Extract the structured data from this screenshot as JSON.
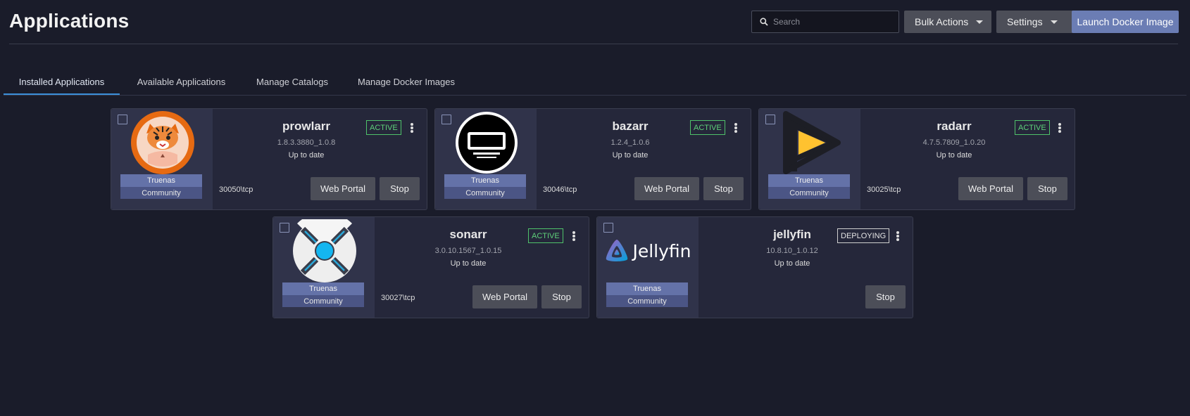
{
  "page": {
    "title": "Applications"
  },
  "search": {
    "placeholder": "Search"
  },
  "header_buttons": {
    "bulk_actions": "Bulk Actions",
    "settings": "Settings",
    "launch": "Launch Docker Image"
  },
  "tabs": [
    {
      "label": "Installed Applications",
      "active": true
    },
    {
      "label": "Available Applications",
      "active": false
    },
    {
      "label": "Manage Catalogs",
      "active": false
    },
    {
      "label": "Manage Docker Images",
      "active": false
    }
  ],
  "apps": [
    {
      "name": "prowlarr",
      "version": "1.8.3.3880_1.0.8",
      "status": "Up to date",
      "state": "ACTIVE",
      "train": "Truenas",
      "train_sub": "Community",
      "port": "30050\\tcp",
      "portal_label": "Web Portal",
      "stop_label": "Stop",
      "icon": "prowlarr-tiger-icon"
    },
    {
      "name": "bazarr",
      "version": "1.2.4_1.0.6",
      "status": "Up to date",
      "state": "ACTIVE",
      "train": "Truenas",
      "train_sub": "Community",
      "port": "30046\\tcp",
      "portal_label": "Web Portal",
      "stop_label": "Stop",
      "icon": "bazarr-screen-icon"
    },
    {
      "name": "radarr",
      "version": "4.7.5.7809_1.0.20",
      "status": "Up to date",
      "state": "ACTIVE",
      "train": "Truenas",
      "train_sub": "Community",
      "port": "30025\\tcp",
      "portal_label": "Web Portal",
      "stop_label": "Stop",
      "icon": "radarr-play-icon"
    },
    {
      "name": "sonarr",
      "version": "3.0.10.1567_1.0.15",
      "status": "Up to date",
      "state": "ACTIVE",
      "train": "Truenas",
      "train_sub": "Community",
      "port": "30027\\tcp",
      "portal_label": "Web Portal",
      "stop_label": "Stop",
      "icon": "sonarr-icon"
    },
    {
      "name": "jellyfin",
      "version": "10.8.10_1.0.12",
      "status": "Up to date",
      "state": "DEPLOYING",
      "train": "Truenas",
      "train_sub": "Community",
      "port": "",
      "portal_label": "",
      "stop_label": "Stop",
      "icon": "jellyfin-logo-icon",
      "logo_text": "Jellyfin"
    }
  ],
  "colors": {
    "accent": "#6b7db4",
    "active": "#5ed07a",
    "tab_underline": "#3b8fd9"
  }
}
